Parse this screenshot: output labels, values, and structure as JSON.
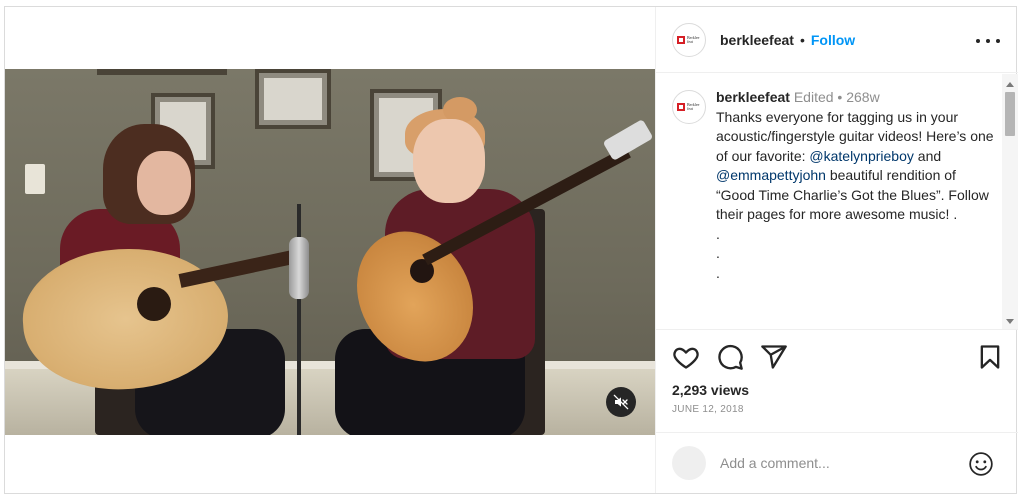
{
  "post": {
    "username": "berkleefeat",
    "follow_label": "Follow",
    "separator": "•",
    "avatar_logo_text": "Berklee feat"
  },
  "caption": {
    "username": "berkleefeat",
    "edited": "Edited",
    "separator": "•",
    "age": "268w",
    "text_part1": "Thanks everyone for tagging us in your acoustic/fingerstyle guitar videos! Here’s one of our favorite: ",
    "mention1": "@katelynprieboy",
    "text_part2": " and ",
    "mention2": "@emmapettyjohn",
    "text_part3": " beautiful rendition of “Good Time Charlie’s Got the Blues”. Follow their pages for more awesome music! .",
    "dots": [
      ".",
      ".",
      "."
    ]
  },
  "stats": {
    "views": "2,293 views",
    "date": "JUNE 12, 2018"
  },
  "comment": {
    "placeholder": "Add a comment..."
  },
  "icons": {
    "like": "heart-icon",
    "comment": "comment-icon",
    "share": "send-icon",
    "save": "bookmark-icon",
    "mute": "muted-speaker-icon",
    "more": "more-options-icon",
    "emoji": "emoji-icon"
  },
  "colors": {
    "link_blue": "#0095f6",
    "mention_blue": "#00376b",
    "meta_gray": "#8e8e8e",
    "brand_red": "#d61f26"
  }
}
